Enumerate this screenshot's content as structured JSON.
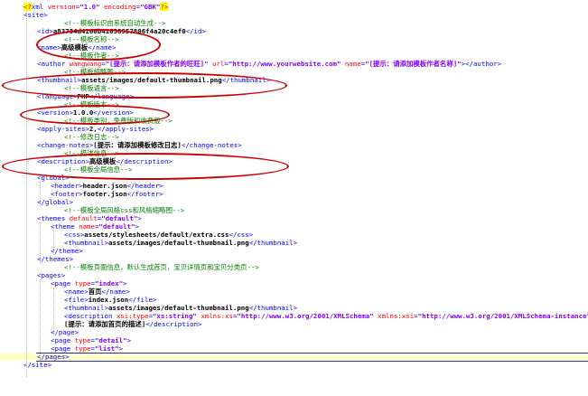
{
  "lines": [
    {
      "indent": 0,
      "parts": [
        {
          "c": "pi-mark",
          "t": "<?"
        },
        {
          "c": "pi",
          "t": "xml "
        },
        {
          "c": "attr",
          "t": "version"
        },
        {
          "c": "pi",
          "t": "="
        },
        {
          "c": "val",
          "t": "\"1.0\" "
        },
        {
          "c": "attr",
          "t": "encoding"
        },
        {
          "c": "pi",
          "t": "="
        },
        {
          "c": "val",
          "t": "\"GBK\""
        },
        {
          "c": "pi-mark",
          "t": "?>"
        }
      ]
    },
    {
      "indent": 0,
      "parts": [
        {
          "c": "tag",
          "t": "<site>"
        }
      ]
    },
    {
      "indent": 3,
      "parts": [
        {
          "c": "com",
          "t": "<!--模板标识由系统自动生成-->"
        }
      ]
    },
    {
      "indent": 1,
      "parts": [
        {
          "c": "tag",
          "t": "<id>"
        },
        {
          "c": "txt",
          "t": "a83784d4160b41658957806f4a20c4ef0"
        },
        {
          "c": "tag",
          "t": "</id>"
        }
      ]
    },
    {
      "indent": 3,
      "parts": [
        {
          "c": "com",
          "t": "<!--模板名称-->"
        }
      ]
    },
    {
      "indent": 1,
      "parts": [
        {
          "c": "tag",
          "t": "<name>"
        },
        {
          "c": "txt",
          "t": "高级模板"
        },
        {
          "c": "tag",
          "t": "</name>"
        }
      ]
    },
    {
      "indent": 3,
      "parts": [
        {
          "c": "com",
          "t": "<!--模板作者-->"
        }
      ]
    },
    {
      "indent": 1,
      "parts": [
        {
          "c": "tag",
          "t": "<author "
        },
        {
          "c": "attr",
          "t": "wangwang"
        },
        {
          "c": "tag",
          "t": "="
        },
        {
          "c": "val",
          "t": "\"[提示：请添加模板作者的旺旺]\" "
        },
        {
          "c": "attr",
          "t": "url"
        },
        {
          "c": "tag",
          "t": "="
        },
        {
          "c": "val",
          "t": "\"http://www.yourwebsite.com\" "
        },
        {
          "c": "attr",
          "t": "name"
        },
        {
          "c": "tag",
          "t": "="
        },
        {
          "c": "val",
          "t": "\"[提示：请添加模板作者名称]\""
        },
        {
          "c": "tag",
          "t": "></author>"
        }
      ]
    },
    {
      "indent": 3,
      "parts": [
        {
          "c": "com",
          "t": "<!--模板缩略图-->"
        }
      ]
    },
    {
      "indent": 1,
      "parts": [
        {
          "c": "tag",
          "t": "<thumbnail>"
        },
        {
          "c": "txt",
          "t": "assets/images/default-thumbnail.png"
        },
        {
          "c": "tag",
          "t": "</thumbnail>"
        }
      ]
    },
    {
      "indent": 3,
      "parts": [
        {
          "c": "com",
          "t": "<!--模板语言-->"
        }
      ]
    },
    {
      "indent": 1,
      "parts": [
        {
          "c": "tag",
          "t": "<language>"
        },
        {
          "c": "txt",
          "t": "PHP"
        },
        {
          "c": "tag",
          "t": "</language>"
        }
      ]
    },
    {
      "indent": 3,
      "parts": [
        {
          "c": "com",
          "t": "<!--模板版本-->"
        }
      ]
    },
    {
      "indent": 1,
      "parts": [
        {
          "c": "tag",
          "t": "<version>"
        },
        {
          "c": "txt",
          "t": "1.0.0"
        },
        {
          "c": "tag",
          "t": "</version>"
        }
      ]
    },
    {
      "indent": 3,
      "parts": [
        {
          "c": "com",
          "t": "<!--模板类别，免费版和收费版-->"
        }
      ]
    },
    {
      "indent": 1,
      "parts": [
        {
          "c": "tag",
          "t": "<apply-sites>"
        },
        {
          "c": "txt",
          "t": "2,"
        },
        {
          "c": "tag",
          "t": "</apply-sites>"
        }
      ]
    },
    {
      "indent": 3,
      "parts": [
        {
          "c": "com",
          "t": "<!--修改日志-->"
        }
      ]
    },
    {
      "indent": 1,
      "parts": [
        {
          "c": "tag",
          "t": "<change-notes>"
        },
        {
          "c": "txt",
          "t": "[提示：请添加模板修改日志]"
        },
        {
          "c": "tag",
          "t": "</change-notes>"
        }
      ]
    },
    {
      "indent": 3,
      "parts": [
        {
          "c": "com",
          "t": "<!--描述信息-->"
        }
      ]
    },
    {
      "indent": 1,
      "parts": [
        {
          "c": "tag",
          "t": "<description>"
        },
        {
          "c": "txt",
          "t": "高级模板"
        },
        {
          "c": "tag",
          "t": "</description>"
        }
      ]
    },
    {
      "indent": 3,
      "parts": [
        {
          "c": "com",
          "t": "<!--模板全局信息-->"
        }
      ]
    },
    {
      "indent": 1,
      "parts": [
        {
          "c": "tag",
          "t": "<global>"
        }
      ]
    },
    {
      "indent": 2,
      "parts": [
        {
          "c": "tag",
          "t": "<header>"
        },
        {
          "c": "txt",
          "t": "header.json"
        },
        {
          "c": "tag",
          "t": "</header>"
        }
      ]
    },
    {
      "indent": 2,
      "parts": [
        {
          "c": "tag",
          "t": "<footer>"
        },
        {
          "c": "txt",
          "t": "footer.json"
        },
        {
          "c": "tag",
          "t": "</footer>"
        }
      ]
    },
    {
      "indent": 1,
      "parts": [
        {
          "c": "tag",
          "t": "</global>"
        }
      ]
    },
    {
      "indent": 3,
      "parts": [
        {
          "c": "com",
          "t": "<!--模板全局风格css和风格缩略图-->"
        }
      ]
    },
    {
      "indent": 1,
      "parts": [
        {
          "c": "tag",
          "t": "<themes "
        },
        {
          "c": "attr",
          "t": "default"
        },
        {
          "c": "tag",
          "t": "="
        },
        {
          "c": "val",
          "t": "\"default\""
        },
        {
          "c": "tag",
          "t": ">"
        }
      ]
    },
    {
      "indent": 2,
      "parts": [
        {
          "c": "tag",
          "t": "<theme "
        },
        {
          "c": "attr",
          "t": "name"
        },
        {
          "c": "tag",
          "t": "="
        },
        {
          "c": "val",
          "t": "\"default\""
        },
        {
          "c": "tag",
          "t": ">"
        }
      ]
    },
    {
      "indent": 3,
      "parts": [
        {
          "c": "tag",
          "t": "<css>"
        },
        {
          "c": "txt",
          "t": "assets/stylesheets/default/extra.css"
        },
        {
          "c": "tag",
          "t": "</css>"
        }
      ]
    },
    {
      "indent": 3,
      "parts": [
        {
          "c": "tag",
          "t": "<thumbnail>"
        },
        {
          "c": "txt",
          "t": "assets/images/default-thumbnail.png"
        },
        {
          "c": "tag",
          "t": "</thumbnail>"
        }
      ]
    },
    {
      "indent": 2,
      "parts": [
        {
          "c": "tag",
          "t": "</theme>"
        }
      ]
    },
    {
      "indent": 1,
      "parts": [
        {
          "c": "tag",
          "t": "</themes>"
        }
      ]
    },
    {
      "indent": 3,
      "parts": [
        {
          "c": "com",
          "t": "<!--模板页面信息，默认生成首页，宝贝详情页和宝贝分类页-->"
        }
      ]
    },
    {
      "indent": 1,
      "parts": [
        {
          "c": "tag",
          "t": "<pages>"
        }
      ]
    },
    {
      "indent": 2,
      "parts": [
        {
          "c": "tag",
          "t": "<page "
        },
        {
          "c": "attr",
          "t": "type"
        },
        {
          "c": "tag",
          "t": "="
        },
        {
          "c": "val",
          "t": "\"index\""
        },
        {
          "c": "tag",
          "t": ">"
        }
      ]
    },
    {
      "indent": 3,
      "parts": [
        {
          "c": "tag",
          "t": "<name>"
        },
        {
          "c": "txt",
          "t": "首页"
        },
        {
          "c": "tag",
          "t": "</name>"
        }
      ]
    },
    {
      "indent": 3,
      "parts": [
        {
          "c": "tag",
          "t": "<file>"
        },
        {
          "c": "txt",
          "t": "index.json"
        },
        {
          "c": "tag",
          "t": "</file>"
        }
      ]
    },
    {
      "indent": 3,
      "parts": [
        {
          "c": "tag",
          "t": "<thumbnail>"
        },
        {
          "c": "txt",
          "t": "assets/images/default-thumbnail.png"
        },
        {
          "c": "tag",
          "t": "</thumbnail>"
        }
      ]
    },
    {
      "indent": 3,
      "parts": [
        {
          "c": "tag",
          "t": "<description "
        },
        {
          "c": "attr",
          "t": "xsi:type"
        },
        {
          "c": "tag",
          "t": "="
        },
        {
          "c": "val",
          "t": "\"xs:string\" "
        },
        {
          "c": "attr",
          "t": "xmlns:xs"
        },
        {
          "c": "tag",
          "t": "="
        },
        {
          "c": "val",
          "t": "\"http://www.w3.org/2001/XMLSchema\" "
        },
        {
          "c": "attr",
          "t": "xmlns:xsi"
        },
        {
          "c": "tag",
          "t": "="
        },
        {
          "c": "val",
          "t": "\"http://www.w3.org/2001/XMLSchema-instance\""
        },
        {
          "c": "tag",
          "t": ">"
        }
      ]
    },
    {
      "indent": 3,
      "parts": [
        {
          "c": "txt",
          "t": "[提示：请添加首页的描述]"
        },
        {
          "c": "tag",
          "t": "</description>"
        }
      ]
    },
    {
      "indent": 2,
      "parts": [
        {
          "c": "tag",
          "t": "</page>"
        }
      ]
    },
    {
      "indent": 2,
      "parts": [
        {
          "c": "tag",
          "t": "<page "
        },
        {
          "c": "attr",
          "t": "type"
        },
        {
          "c": "tag",
          "t": "="
        },
        {
          "c": "val",
          "t": "\"detail\""
        },
        {
          "c": "tag",
          "t": ">"
        }
      ]
    },
    {
      "indent": 2,
      "parts": [
        {
          "c": "tag",
          "t": "<page "
        },
        {
          "c": "attr",
          "t": "type"
        },
        {
          "c": "tag",
          "t": "="
        },
        {
          "c": "val",
          "t": "\"list\""
        },
        {
          "c": "tag",
          "t": ">"
        }
      ]
    },
    {
      "indent": 1,
      "parts": [
        {
          "c": "tag",
          "t": "</pages>"
        }
      ]
    },
    {
      "indent": 0,
      "parts": [
        {
          "c": "tag",
          "t": "</site>"
        }
      ]
    }
  ],
  "highlight_line": 43,
  "colors": {
    "annotation": "#cc0000",
    "tag": "#0000ff",
    "attr": "#ff0000",
    "value": "#8000ff",
    "comment": "#008000"
  }
}
